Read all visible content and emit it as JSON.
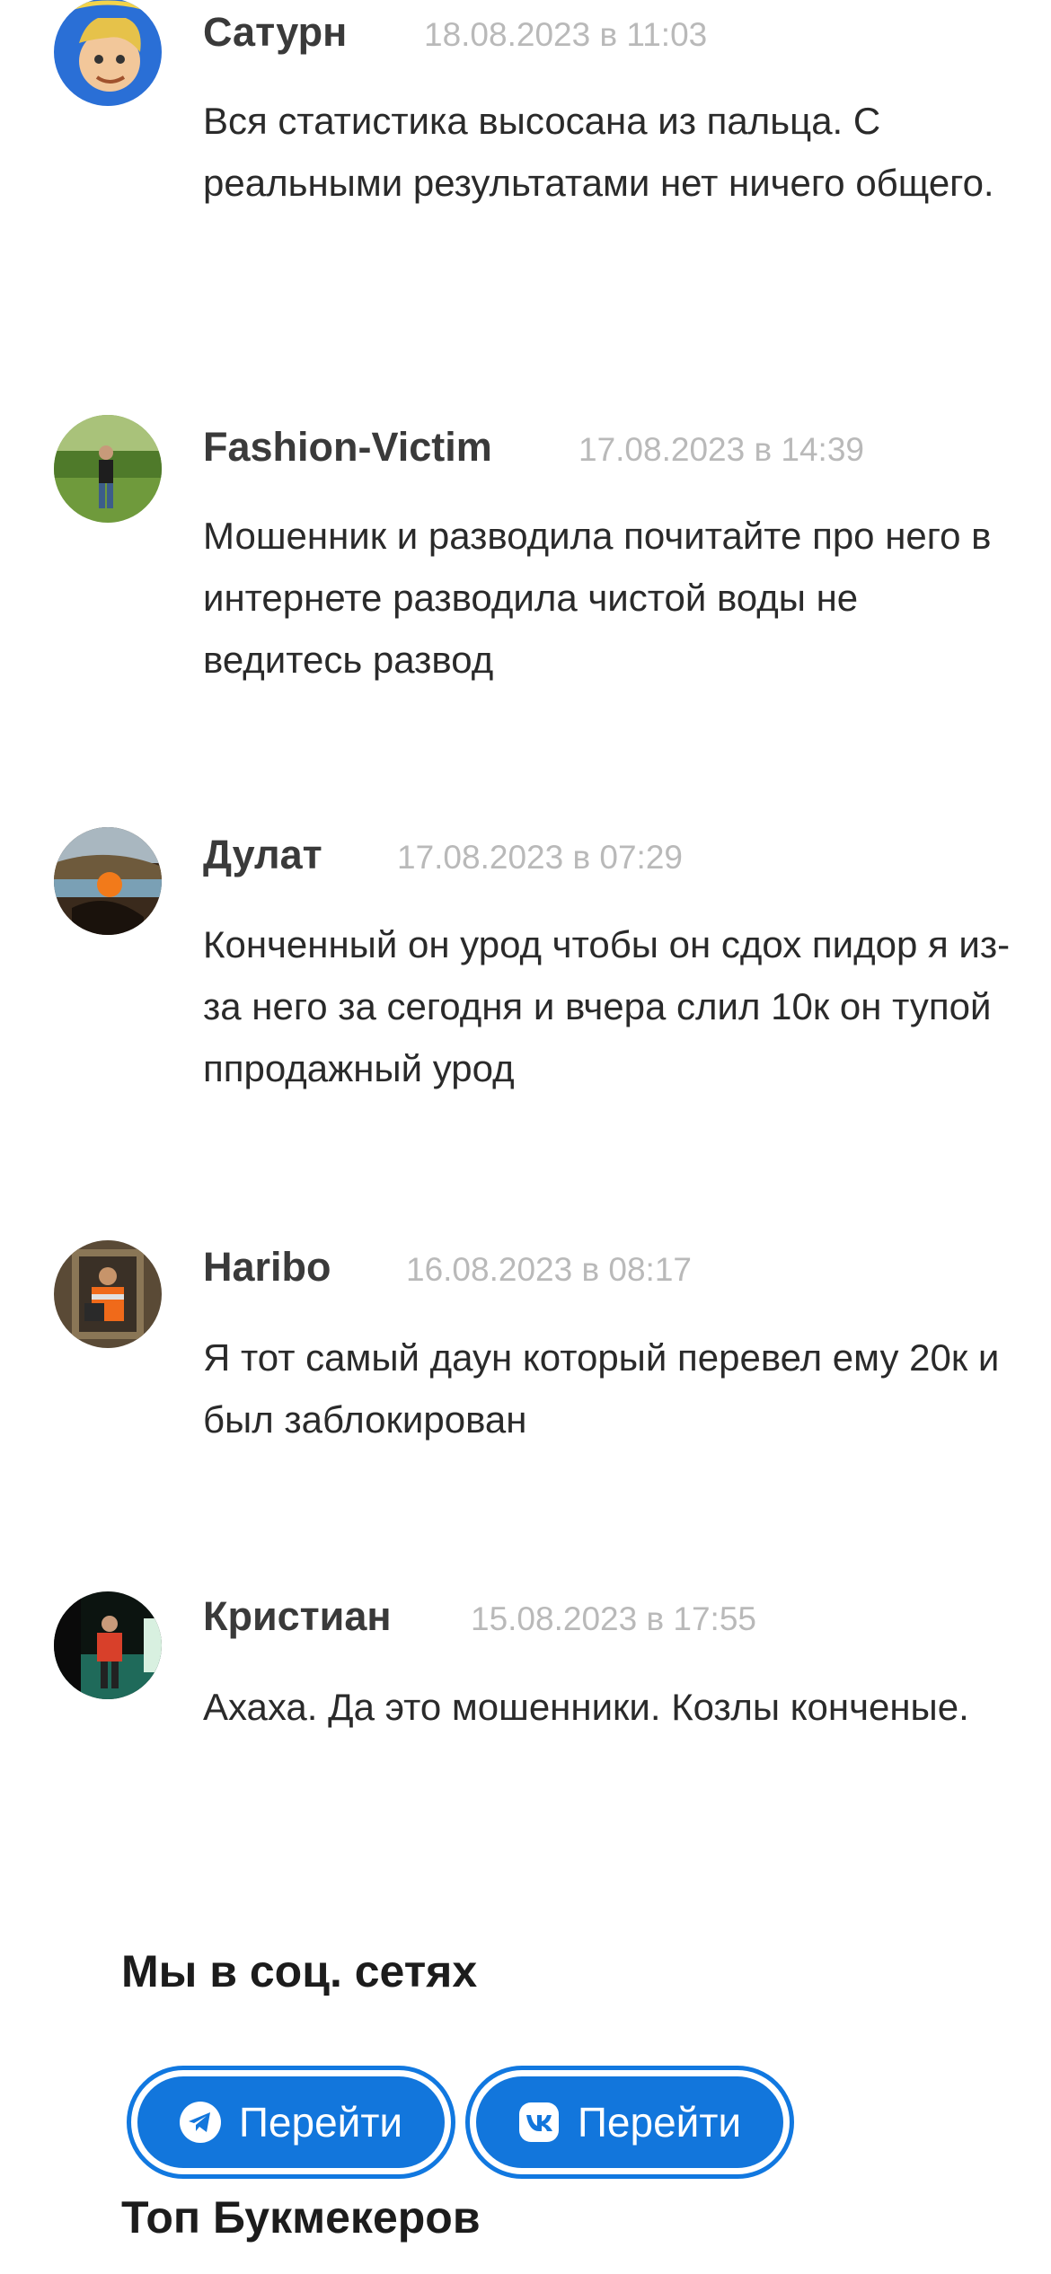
{
  "comments": [
    {
      "author": "Сатурн",
      "date": "18.08.2023 в 11:03",
      "text": "Вся статистика высосана из пальца. С реальными результатами нет ничего общего.",
      "avatar_icon": "cartoon-avatar-icon"
    },
    {
      "author": "Fashion-Victim",
      "date": "17.08.2023 в 14:39",
      "text": "Мошенник и разводила почитайте про него в интернете разводила чистой воды не ведитесь развод",
      "avatar_icon": "person-in-field-avatar-icon"
    },
    {
      "author": "Дулат",
      "date": "17.08.2023 в 07:29",
      "text": "Конченный он урод чтобы он сдох пидор я из-за него за сегодня и вчера слил 10к он тупой ппродажный урод",
      "avatar_icon": "sunset-avatar-icon"
    },
    {
      "author": "Haribo",
      "date": "16.08.2023 в 08:17",
      "text": "Я тот самый даун который перевел ему 20к и был заблокирован",
      "avatar_icon": "person-orange-avatar-icon"
    },
    {
      "author": "Кристиан",
      "date": "15.08.2023 в 17:55",
      "text": "Ахаха. Да это мошенники. Козлы конченые.",
      "avatar_icon": "person-night-avatar-icon"
    }
  ],
  "social": {
    "title": "Мы в соц. сетях",
    "telegram_label": "Перейти",
    "telegram_icon": "telegram-icon",
    "vk_label": "Перейти",
    "vk_icon": "vk-icon"
  },
  "bookmakers": {
    "title": "Топ Букмекеров"
  },
  "colors": {
    "button_blue": "#1276dc",
    "date_gray": "#b9b9b9",
    "name_dark": "#3a3a3a"
  }
}
